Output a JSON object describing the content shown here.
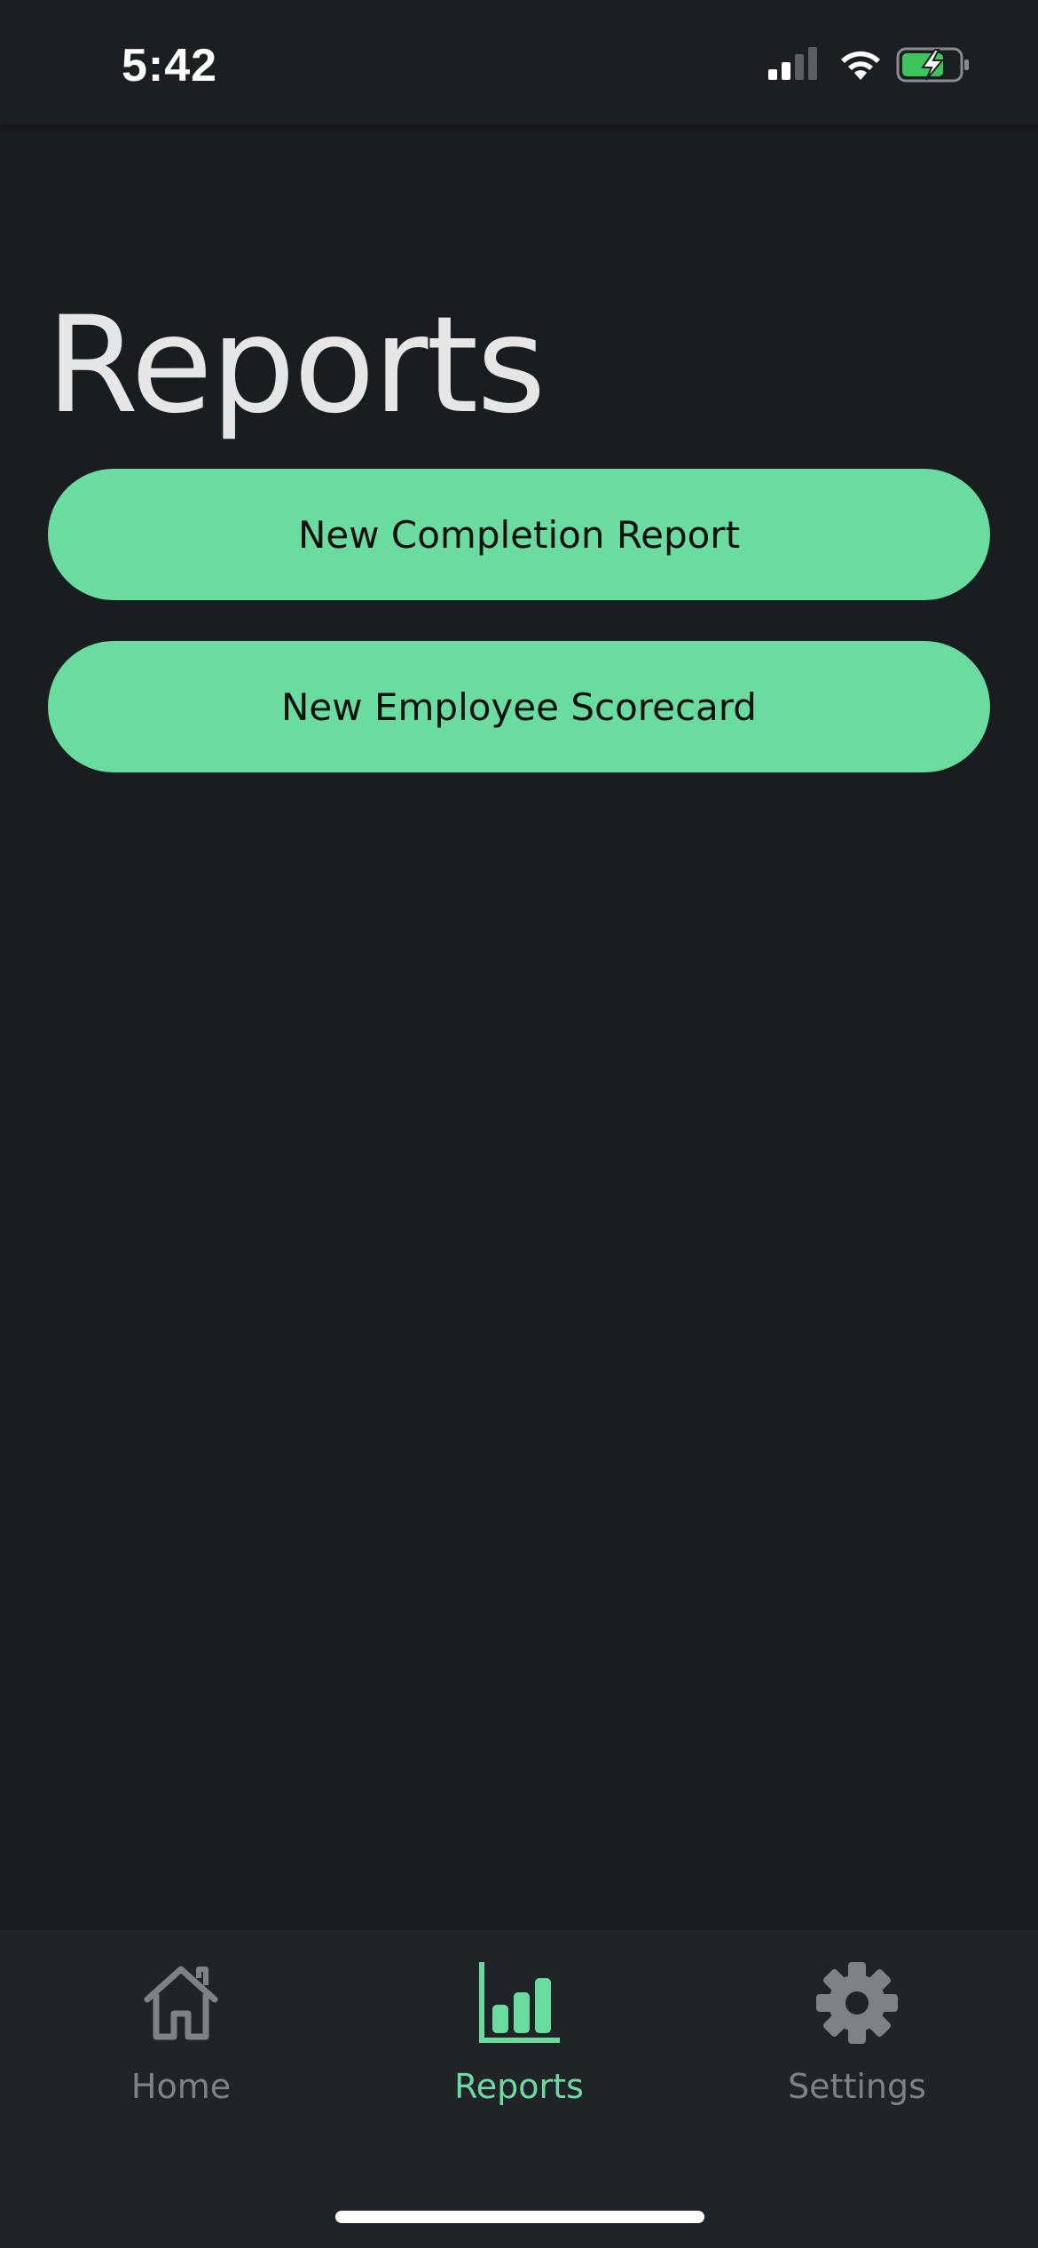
{
  "status_bar": {
    "time": "5:42",
    "icons": [
      "cellular-signal-icon",
      "wifi-icon",
      "battery-charging-icon"
    ]
  },
  "page": {
    "title": "Reports"
  },
  "actions": {
    "new_completion_report": "New Completion Report",
    "new_employee_scorecard": "New Employee Scorecard"
  },
  "tab_bar": {
    "items": [
      {
        "label": "Home",
        "icon": "home-icon",
        "active": false
      },
      {
        "label": "Reports",
        "icon": "bar-chart-icon",
        "active": true
      },
      {
        "label": "Settings",
        "icon": "gear-icon",
        "active": false
      }
    ]
  },
  "colors": {
    "background": "#1a1d20",
    "accent": "#6adca0",
    "tab_bar": "#202428",
    "inactive": "#7e8285"
  }
}
